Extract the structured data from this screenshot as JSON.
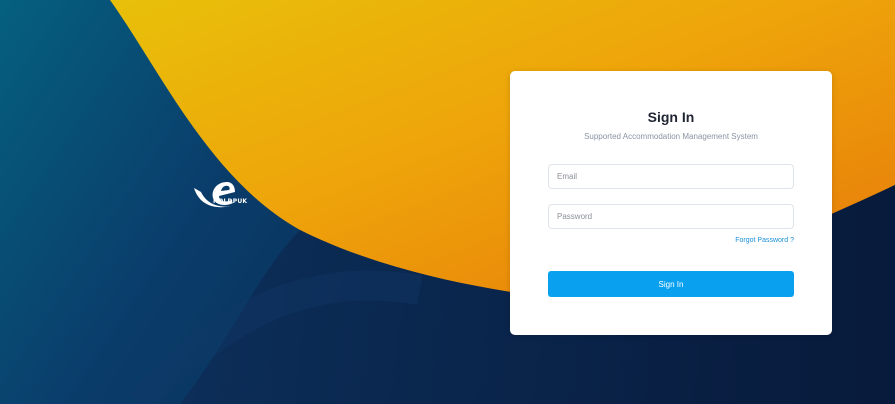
{
  "background": {
    "colors": {
      "navy": "#0b2346",
      "teal": "#05607f",
      "orange": "#eb8a0c",
      "yellow": "#e8b80a"
    }
  },
  "logo": {
    "icon": "brand-e-swoosh-icon",
    "text": "HOLDPUK"
  },
  "signin": {
    "title": "Sign In",
    "subtitle": "Supported Accommodation Management System",
    "email_placeholder": "Email",
    "email_value": "",
    "password_placeholder": "Password",
    "password_value": "",
    "forgot_label": "Forgot Password ?",
    "button_label": "Sign In",
    "button_color": "#0aa0f0",
    "link_color": "#1a8fd6"
  }
}
